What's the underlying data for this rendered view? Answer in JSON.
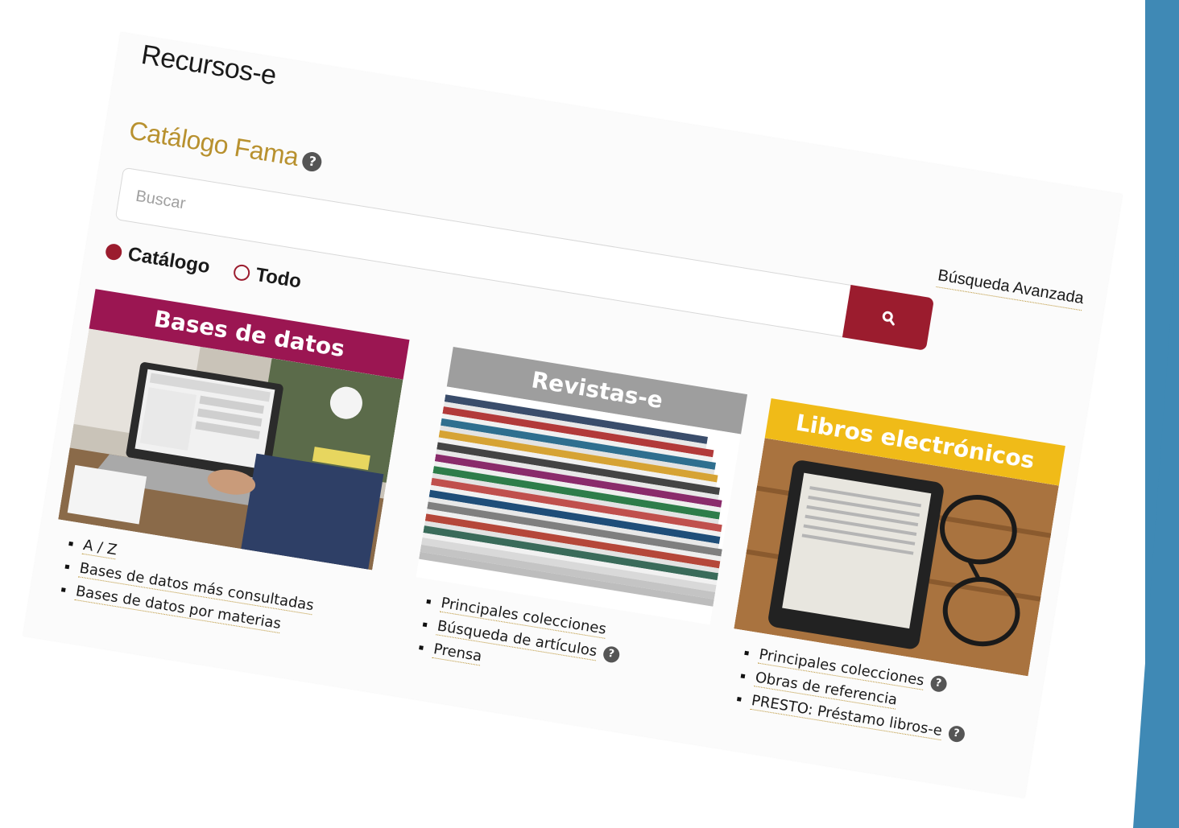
{
  "page": {
    "heading": "Recursos-e"
  },
  "catalog": {
    "title": "Catálogo Fama",
    "help": "?",
    "search_placeholder": "Buscar",
    "radio_catalog": "Catálogo",
    "radio_all": "Todo",
    "advanced_search": "Búsqueda Avanzada"
  },
  "tiles": [
    {
      "banner": "Bases de datos",
      "banner_color": "#9b1652",
      "links": [
        "A / Z",
        "Bases de datos más consultadas",
        "Bases de datos por materias"
      ]
    },
    {
      "banner": "Revistas-e",
      "banner_color": "#9e9e9e",
      "links": [
        "Principales colecciones",
        "Búsqueda de artículos",
        "Prensa"
      ]
    },
    {
      "banner": "Libros electrónicos",
      "banner_color": "#f0bb18",
      "links": [
        "Principales colecciones",
        "Obras de referencia",
        "PRESTO: Préstamo libros-e"
      ]
    }
  ],
  "colors": {
    "accent_gold": "#b8912f",
    "accent_maroon": "#9b1c2e",
    "side_blue": "#3f89b5"
  }
}
